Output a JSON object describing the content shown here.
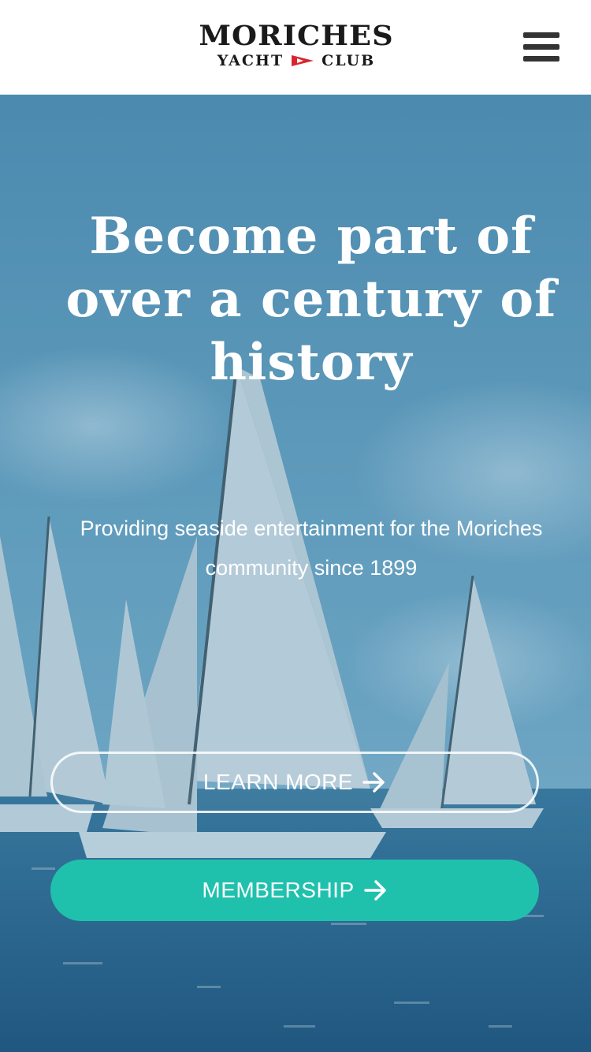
{
  "header": {
    "logo": {
      "title": "MORICHES",
      "sub_left": "YACHT",
      "sub_right": "CLUB"
    },
    "menu_icon": "hamburger-menu-icon"
  },
  "hero": {
    "headline": "Become part of over a century of history",
    "subtext": "Providing seaside entertainment for the Moriches community since 1899",
    "buttons": {
      "learn_more": "LEARN MORE",
      "membership": "MEMBERSHIP"
    }
  },
  "colors": {
    "accent": "#1fc1ad",
    "flag": "#d8262e",
    "menu": "#333333"
  }
}
